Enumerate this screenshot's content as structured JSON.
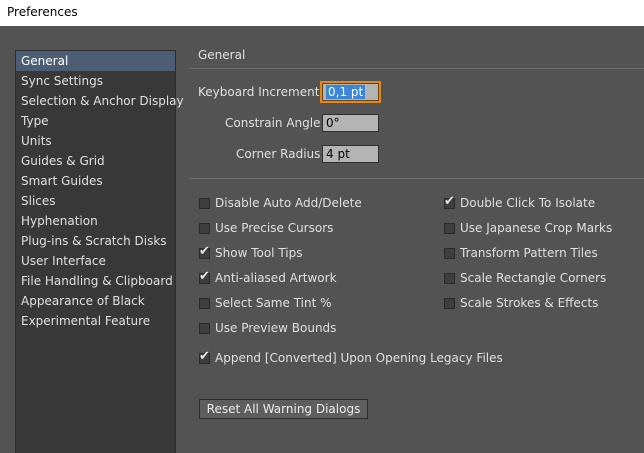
{
  "window": {
    "title": "Preferences"
  },
  "sidebar": {
    "items": [
      {
        "label": "General",
        "selected": true
      },
      {
        "label": "Sync Settings"
      },
      {
        "label": "Selection & Anchor Display"
      },
      {
        "label": "Type"
      },
      {
        "label": "Units"
      },
      {
        "label": "Guides & Grid"
      },
      {
        "label": "Smart Guides"
      },
      {
        "label": "Slices"
      },
      {
        "label": "Hyphenation"
      },
      {
        "label": "Plug-ins & Scratch Disks"
      },
      {
        "label": "User Interface"
      },
      {
        "label": "File Handling & Clipboard"
      },
      {
        "label": "Appearance of Black"
      },
      {
        "label": "Experimental Feature"
      }
    ]
  },
  "main": {
    "section_title": "General",
    "fields": {
      "keyboard_increment": {
        "label": "Keyboard Increment:",
        "value": "0,1 pt"
      },
      "constrain_angle": {
        "label": "Constrain Angle:",
        "value": "0°"
      },
      "corner_radius": {
        "label": "Corner Radius:",
        "value": "4 pt"
      }
    },
    "checkboxes_left": [
      {
        "label": "Disable Auto Add/Delete",
        "checked": false
      },
      {
        "label": "Use Precise Cursors",
        "checked": false
      },
      {
        "label": "Show Tool Tips",
        "checked": true
      },
      {
        "label": "Anti-aliased Artwork",
        "checked": true
      },
      {
        "label": "Select Same Tint %",
        "checked": false
      },
      {
        "label": "Use Preview Bounds",
        "checked": false
      },
      {
        "label": "Append [Converted] Upon Opening Legacy Files",
        "checked": true
      }
    ],
    "checkboxes_right": [
      {
        "label": "Double Click To Isolate",
        "checked": true
      },
      {
        "label": "Use Japanese Crop Marks",
        "checked": false
      },
      {
        "label": "Transform Pattern Tiles",
        "checked": false
      },
      {
        "label": "Scale Rectangle Corners",
        "checked": false
      },
      {
        "label": "Scale Strokes & Effects",
        "checked": false
      }
    ],
    "reset_button": "Reset All Warning Dialogs"
  },
  "icons": {
    "check": "checkmark-icon"
  }
}
